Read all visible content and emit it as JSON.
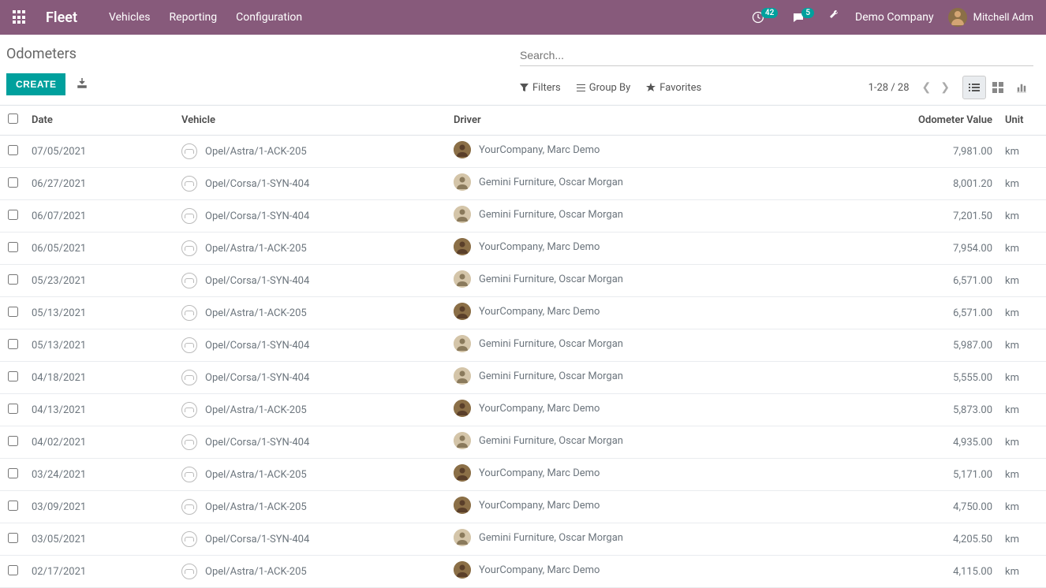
{
  "header": {
    "brand": "Fleet",
    "nav": [
      "Vehicles",
      "Reporting",
      "Configuration"
    ],
    "badge1": "42",
    "badge2": "5",
    "company": "Demo Company",
    "user": "Mitchell Adm"
  },
  "page": {
    "title": "Odometers",
    "create": "CREATE",
    "search_placeholder": "Search...",
    "filters": "Filters",
    "group_by": "Group By",
    "favorites": "Favorites",
    "pager": "1-28 / 28"
  },
  "columns": {
    "date": "Date",
    "vehicle": "Vehicle",
    "driver": "Driver",
    "odometer": "Odometer Value",
    "unit": "Unit"
  },
  "rows": [
    {
      "date": "07/05/2021",
      "vehicle": "Opel/Astra/1-ACK-205",
      "driver": "YourCompany, Marc Demo",
      "odo": "7,981.00",
      "unit": "km",
      "dtype": "a"
    },
    {
      "date": "06/27/2021",
      "vehicle": "Opel/Corsa/1-SYN-404",
      "driver": "Gemini Furniture, Oscar Morgan",
      "odo": "8,001.20",
      "unit": "km",
      "dtype": "b"
    },
    {
      "date": "06/07/2021",
      "vehicle": "Opel/Corsa/1-SYN-404",
      "driver": "Gemini Furniture, Oscar Morgan",
      "odo": "7,201.50",
      "unit": "km",
      "dtype": "b"
    },
    {
      "date": "06/05/2021",
      "vehicle": "Opel/Astra/1-ACK-205",
      "driver": "YourCompany, Marc Demo",
      "odo": "7,954.00",
      "unit": "km",
      "dtype": "a"
    },
    {
      "date": "05/23/2021",
      "vehicle": "Opel/Corsa/1-SYN-404",
      "driver": "Gemini Furniture, Oscar Morgan",
      "odo": "6,571.00",
      "unit": "km",
      "dtype": "b"
    },
    {
      "date": "05/13/2021",
      "vehicle": "Opel/Astra/1-ACK-205",
      "driver": "YourCompany, Marc Demo",
      "odo": "6,571.00",
      "unit": "km",
      "dtype": "a"
    },
    {
      "date": "05/13/2021",
      "vehicle": "Opel/Corsa/1-SYN-404",
      "driver": "Gemini Furniture, Oscar Morgan",
      "odo": "5,987.00",
      "unit": "km",
      "dtype": "b"
    },
    {
      "date": "04/18/2021",
      "vehicle": "Opel/Corsa/1-SYN-404",
      "driver": "Gemini Furniture, Oscar Morgan",
      "odo": "5,555.00",
      "unit": "km",
      "dtype": "b"
    },
    {
      "date": "04/13/2021",
      "vehicle": "Opel/Astra/1-ACK-205",
      "driver": "YourCompany, Marc Demo",
      "odo": "5,873.00",
      "unit": "km",
      "dtype": "a"
    },
    {
      "date": "04/02/2021",
      "vehicle": "Opel/Corsa/1-SYN-404",
      "driver": "Gemini Furniture, Oscar Morgan",
      "odo": "4,935.00",
      "unit": "km",
      "dtype": "b"
    },
    {
      "date": "03/24/2021",
      "vehicle": "Opel/Astra/1-ACK-205",
      "driver": "YourCompany, Marc Demo",
      "odo": "5,171.00",
      "unit": "km",
      "dtype": "a"
    },
    {
      "date": "03/09/2021",
      "vehicle": "Opel/Astra/1-ACK-205",
      "driver": "YourCompany, Marc Demo",
      "odo": "4,750.00",
      "unit": "km",
      "dtype": "a"
    },
    {
      "date": "03/05/2021",
      "vehicle": "Opel/Corsa/1-SYN-404",
      "driver": "Gemini Furniture, Oscar Morgan",
      "odo": "4,205.50",
      "unit": "km",
      "dtype": "b"
    },
    {
      "date": "02/17/2021",
      "vehicle": "Opel/Astra/1-ACK-205",
      "driver": "YourCompany, Marc Demo",
      "odo": "4,115.00",
      "unit": "km",
      "dtype": "a"
    }
  ]
}
